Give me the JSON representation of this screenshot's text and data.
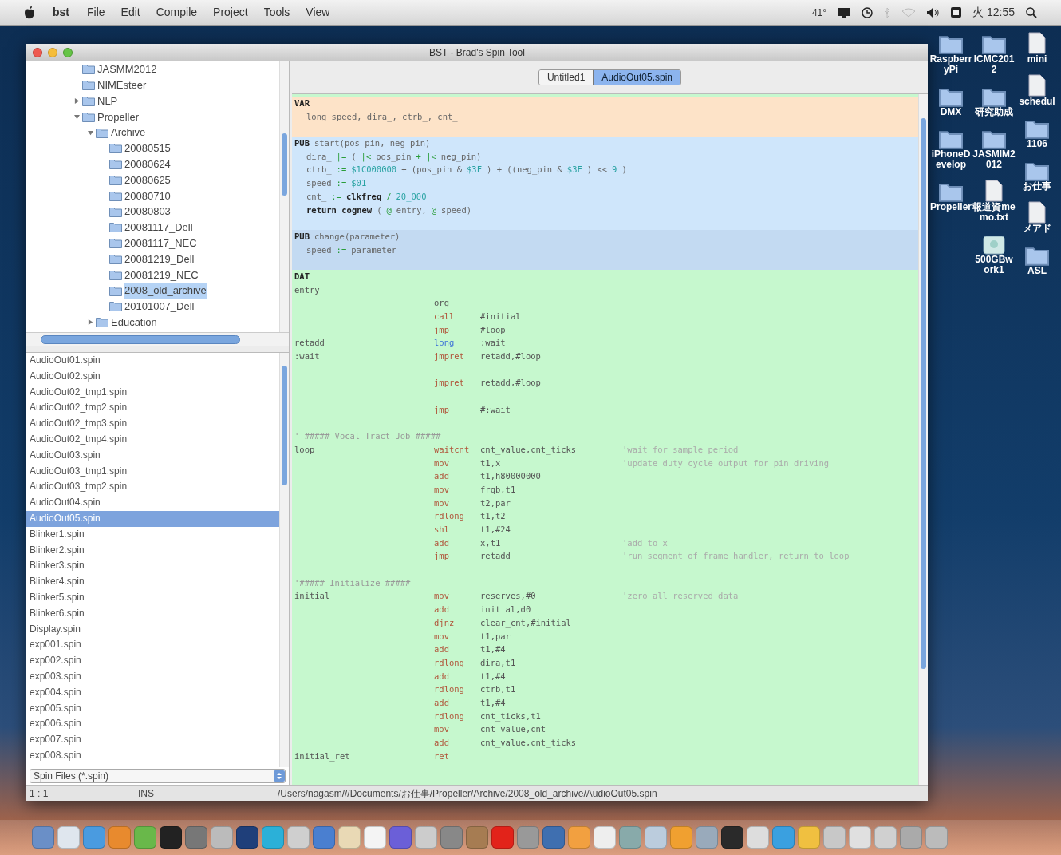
{
  "menu_bar": {
    "app": "bst",
    "items": [
      "File",
      "Edit",
      "Compile",
      "Project",
      "Tools",
      "View"
    ],
    "temperature": "41°",
    "clock": "火 12:55"
  },
  "window": {
    "title": "BST - Brad's Spin Tool",
    "tree": [
      {
        "label": "JASMM2012",
        "kind": "leaf",
        "selected": false
      },
      {
        "label": "NIMEsteer",
        "kind": "leaf",
        "selected": false
      },
      {
        "label": "NLP",
        "kind": "group",
        "expanded": false,
        "selected": false
      },
      {
        "label": "Propeller",
        "kind": "group",
        "expanded": true,
        "selected": false,
        "children": [
          {
            "label": "Archive",
            "kind": "group",
            "expanded": true,
            "selected": false,
            "children": [
              {
                "label": "20080515",
                "kind": "leaf",
                "selected": false
              },
              {
                "label": "20080624",
                "kind": "leaf",
                "selected": false
              },
              {
                "label": "20080625",
                "kind": "leaf",
                "selected": false
              },
              {
                "label": "20080710",
                "kind": "leaf",
                "selected": false
              },
              {
                "label": "20080803",
                "kind": "leaf",
                "selected": false
              },
              {
                "label": "20081117_Dell",
                "kind": "leaf",
                "selected": false
              },
              {
                "label": "20081117_NEC",
                "kind": "leaf",
                "selected": false
              },
              {
                "label": "20081219_Dell",
                "kind": "leaf",
                "selected": false
              },
              {
                "label": "20081219_NEC",
                "kind": "leaf",
                "selected": false
              },
              {
                "label": "2008_old_archive",
                "kind": "leaf",
                "selected": true
              },
              {
                "label": "20101007_Dell",
                "kind": "leaf",
                "selected": false
              }
            ]
          },
          {
            "label": "Education",
            "kind": "group",
            "expanded": false,
            "selected": false
          }
        ]
      }
    ],
    "files": [
      {
        "name": "AudioOut01.spin",
        "selected": false
      },
      {
        "name": "AudioOut02.spin",
        "selected": false
      },
      {
        "name": "AudioOut02_tmp1.spin",
        "selected": false
      },
      {
        "name": "AudioOut02_tmp2.spin",
        "selected": false
      },
      {
        "name": "AudioOut02_tmp3.spin",
        "selected": false
      },
      {
        "name": "AudioOut02_tmp4.spin",
        "selected": false
      },
      {
        "name": "AudioOut03.spin",
        "selected": false
      },
      {
        "name": "AudioOut03_tmp1.spin",
        "selected": false
      },
      {
        "name": "AudioOut03_tmp2.spin",
        "selected": false
      },
      {
        "name": "AudioOut04.spin",
        "selected": false
      },
      {
        "name": "AudioOut05.spin",
        "selected": true
      },
      {
        "name": "Blinker1.spin",
        "selected": false
      },
      {
        "name": "Blinker2.spin",
        "selected": false
      },
      {
        "name": "Blinker3.spin",
        "selected": false
      },
      {
        "name": "Blinker4.spin",
        "selected": false
      },
      {
        "name": "Blinker5.spin",
        "selected": false
      },
      {
        "name": "Blinker6.spin",
        "selected": false
      },
      {
        "name": "Display.spin",
        "selected": false
      },
      {
        "name": "exp001.spin",
        "selected": false
      },
      {
        "name": "exp002.spin",
        "selected": false
      },
      {
        "name": "exp003.spin",
        "selected": false
      },
      {
        "name": "exp004.spin",
        "selected": false
      },
      {
        "name": "exp005.spin",
        "selected": false
      },
      {
        "name": "exp006.spin",
        "selected": false
      },
      {
        "name": "exp007.spin",
        "selected": false
      },
      {
        "name": "exp008.spin",
        "selected": false
      }
    ],
    "file_filter": "Spin Files (*.spin)",
    "tabs": [
      {
        "label": "Untitled1",
        "selected": false
      },
      {
        "label": "AudioOut05.spin",
        "selected": true
      }
    ],
    "code_sections": [
      {
        "kind": "var",
        "header": [
          {
            "text": "VAR",
            "kind": "block"
          }
        ],
        "body": [
          [
            {
              "text": "long speed, dira_, ctrb_, cnt_",
              "kind": "plain"
            }
          ]
        ]
      },
      {
        "kind": "pub",
        "header": [
          {
            "text": "PUB",
            "kind": "block"
          },
          {
            "text": "start(pos_pin, neg_pin)",
            "kind": "plain"
          }
        ],
        "body": [
          [
            {
              "text": "dira_",
              "kind": "plain"
            },
            {
              "text": "|=",
              "kind": "op"
            },
            {
              "text": "(",
              "kind": "plain"
            },
            {
              "text": "|<",
              "kind": "op"
            },
            {
              "text": "pos_pin",
              "kind": "plain"
            },
            {
              "text": "+ |<",
              "kind": "op"
            },
            {
              "text": "neg_pin)",
              "kind": "plain"
            }
          ],
          [
            {
              "text": "ctrb_",
              "kind": "plain"
            },
            {
              "text": ":=",
              "kind": "op"
            },
            {
              "text": "$1C000000",
              "kind": "num"
            },
            {
              "text": "+ (pos_pin &",
              "kind": "plain"
            },
            {
              "text": "$3F",
              "kind": "num"
            },
            {
              "text": ") + ((neg_pin &",
              "kind": "plain"
            },
            {
              "text": "$3F",
              "kind": "num"
            },
            {
              "text": ") <<",
              "kind": "plain"
            },
            {
              "text": "9",
              "kind": "num"
            },
            {
              "text": ")",
              "kind": "plain"
            }
          ],
          [
            {
              "text": "speed",
              "kind": "plain"
            },
            {
              "text": ":=",
              "kind": "op"
            },
            {
              "text": "$01",
              "kind": "num"
            }
          ],
          [
            {
              "text": "cnt_",
              "kind": "plain"
            },
            {
              "text": ":=",
              "kind": "op"
            },
            {
              "text": "clkfreq",
              "kind": "bold"
            },
            {
              "text": "/",
              "kind": "op"
            },
            {
              "text": "20_000",
              "kind": "num"
            }
          ],
          [
            {
              "text": "return cognew",
              "kind": "bold"
            },
            {
              "text": "(",
              "kind": "plain"
            },
            {
              "text": "@",
              "kind": "op"
            },
            {
              "text": "entry,",
              "kind": "plain"
            },
            {
              "text": "@",
              "kind": "op"
            },
            {
              "text": "speed)",
              "kind": "plain"
            }
          ]
        ]
      },
      {
        "kind": "pub_alt",
        "header": [
          {
            "text": "PUB",
            "kind": "block"
          },
          {
            "text": "change(parameter)",
            "kind": "plain"
          }
        ],
        "body": [
          [
            {
              "text": "speed",
              "kind": "plain"
            },
            {
              "text": ":=",
              "kind": "op"
            },
            {
              "text": "parameter",
              "kind": "plain"
            }
          ]
        ]
      },
      {
        "kind": "dat",
        "header": [
          {
            "text": "DAT",
            "kind": "block"
          }
        ],
        "lines": [
          {
            "kind": "instr",
            "label": "entry"
          },
          {
            "kind": "instr",
            "op": "org",
            "color": "#555555"
          },
          {
            "kind": "instr",
            "op": "call",
            "color": "#b0553a",
            "args": "#initial"
          },
          {
            "kind": "instr",
            "op": "jmp",
            "color": "#b0553a",
            "args": "#loop"
          },
          {
            "kind": "instr",
            "label": "retadd",
            "op": "long",
            "color": "#3a6fd8",
            "args": ":wait"
          },
          {
            "kind": "instr",
            "label": ":wait",
            "op": "jmpret",
            "color": "#b0553a",
            "args": "retadd,#loop"
          },
          {
            "kind": "blank"
          },
          {
            "kind": "instr",
            "op": "jmpret",
            "color": "#b0553a",
            "args": "retadd,#loop"
          },
          {
            "kind": "blank"
          },
          {
            "kind": "instr",
            "op": "jmp",
            "color": "#b0553a",
            "args": "#:wait"
          },
          {
            "kind": "blank"
          },
          {
            "kind": "comment",
            "text": "' ##### Vocal Tract Job #####"
          },
          {
            "kind": "instr",
            "label": "loop",
            "op": "waitcnt",
            "color": "#b0553a",
            "args": "cnt_value,cnt_ticks",
            "comment": "'wait for sample period"
          },
          {
            "kind": "instr",
            "op": "mov",
            "color": "#b0553a",
            "args": "t1,x",
            "comment": "'update duty cycle output for pin driving"
          },
          {
            "kind": "instr",
            "op": "add",
            "color": "#b0553a",
            "args": "t1,h80000000"
          },
          {
            "kind": "instr",
            "op": "mov",
            "color": "#b0553a",
            "args": "frqb,t1"
          },
          {
            "kind": "instr",
            "op": "mov",
            "color": "#b0553a",
            "args": "t2,par"
          },
          {
            "kind": "instr",
            "op": "rdlong",
            "color": "#b0553a",
            "args": "t1,t2"
          },
          {
            "kind": "instr",
            "op": "shl",
            "color": "#b0553a",
            "args": "t1,#24"
          },
          {
            "kind": "instr",
            "op": "add",
            "color": "#b0553a",
            "args": "x,t1",
            "comment": "'add to x"
          },
          {
            "kind": "instr",
            "op": "jmp",
            "color": "#b0553a",
            "args": "retadd",
            "comment": "'run segment of frame handler, return to loop"
          },
          {
            "kind": "blank"
          },
          {
            "kind": "comment",
            "text": "'##### Initialize #####"
          },
          {
            "kind": "instr",
            "label": "initial",
            "op": "mov",
            "color": "#b0553a",
            "args": "reserves,#0",
            "comment": "'zero all reserved data"
          },
          {
            "kind": "instr",
            "op": "add",
            "color": "#b0553a",
            "args": "initial,d0"
          },
          {
            "kind": "instr",
            "op": "djnz",
            "color": "#b0553a",
            "args": "clear_cnt,#initial"
          },
          {
            "kind": "instr",
            "op": "mov",
            "color": "#b0553a",
            "args": "t1,par"
          },
          {
            "kind": "instr",
            "op": "add",
            "color": "#b0553a",
            "args": "t1,#4"
          },
          {
            "kind": "instr",
            "op": "rdlong",
            "color": "#b0553a",
            "args": "dira,t1"
          },
          {
            "kind": "instr",
            "op": "add",
            "color": "#b0553a",
            "args": "t1,#4"
          },
          {
            "kind": "instr",
            "op": "rdlong",
            "color": "#b0553a",
            "args": "ctrb,t1"
          },
          {
            "kind": "instr",
            "op": "add",
            "color": "#b0553a",
            "args": "t1,#4"
          },
          {
            "kind": "instr",
            "op": "rdlong",
            "color": "#b0553a",
            "args": "cnt_ticks,t1"
          },
          {
            "kind": "instr",
            "op": "mov",
            "color": "#b0553a",
            "args": "cnt_value,cnt"
          },
          {
            "kind": "instr",
            "op": "add",
            "color": "#b0553a",
            "args": "cnt_value,cnt_ticks"
          },
          {
            "kind": "instr",
            "label": "initial_ret",
            "op": "ret",
            "color": "#b0553a"
          }
        ]
      }
    ],
    "status": {
      "position": "1 : 1",
      "mode": "INS",
      "path": "/Users/nagasm///Documents/お仕事/Propeller/Archive/2008_old_archive/AudioOut05.spin"
    }
  },
  "desktop_columns": [
    [
      {
        "label": "RaspberryPi",
        "kind": "folder"
      },
      {
        "label": "DMX",
        "kind": "folder"
      },
      {
        "label": "iPhoneDevelop",
        "kind": "folder"
      },
      {
        "label": "Propeller",
        "kind": "folder"
      }
    ],
    [
      {
        "label": "ICMC2012",
        "kind": "folder"
      },
      {
        "label": "研究助成",
        "kind": "folder"
      },
      {
        "label": "JASMIM2012",
        "kind": "folder"
      },
      {
        "label": "報道資memo.txt",
        "kind": "document"
      },
      {
        "label": "500GBwork1",
        "kind": "drive"
      }
    ],
    [
      {
        "label": "mini",
        "kind": "document"
      },
      {
        "label": "schedul",
        "kind": "document"
      },
      {
        "label": "1106",
        "kind": "folder"
      },
      {
        "label": "お仕事",
        "kind": "folder"
      },
      {
        "label": "メアド",
        "kind": "document"
      },
      {
        "label": "ASL",
        "kind": "folder"
      }
    ]
  ]
}
